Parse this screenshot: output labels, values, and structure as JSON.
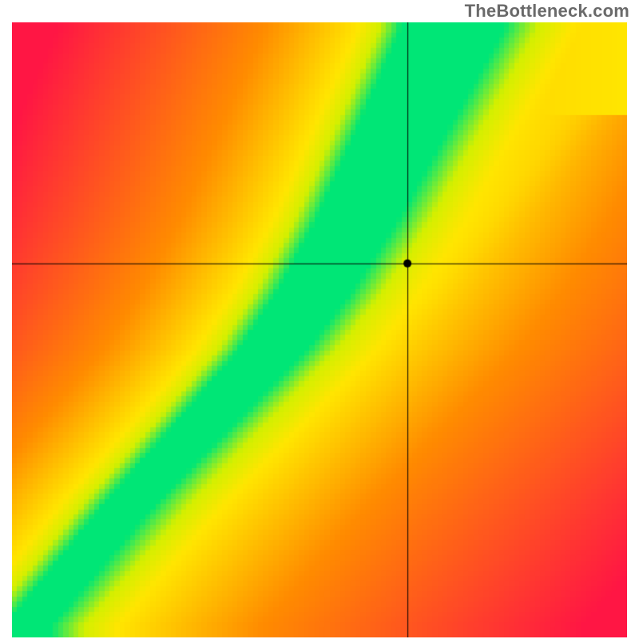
{
  "watermark": "TheBottleneck.com",
  "chart_data": {
    "type": "heatmap",
    "title": "",
    "xlabel": "",
    "ylabel": "",
    "xlim": [
      0,
      1
    ],
    "ylim": [
      0,
      1
    ],
    "crosshair": {
      "x": 0.643,
      "y": 0.608
    },
    "palette": {
      "red": "#ff1744",
      "orange": "#ff8c00",
      "yellow": "#ffe600",
      "yellowgreen": "#d4f000",
      "green": "#00e676"
    },
    "ridge": {
      "description": "Green optimal band: start narrow bottom-left, bow slightly right through center, end near top with right edge ~ x=0.75",
      "points_center": [
        {
          "x": 0.02,
          "y": 0.02
        },
        {
          "x": 0.19,
          "y": 0.22
        },
        {
          "x": 0.32,
          "y": 0.36
        },
        {
          "x": 0.42,
          "y": 0.47
        },
        {
          "x": 0.49,
          "y": 0.57
        },
        {
          "x": 0.555,
          "y": 0.68
        },
        {
          "x": 0.605,
          "y": 0.78
        },
        {
          "x": 0.655,
          "y": 0.88
        },
        {
          "x": 0.71,
          "y": 0.99
        }
      ],
      "width_bottom": 0.015,
      "width_top": 0.11
    },
    "secondary_ridge": {
      "description": "faint yellow ridge to the right of the main band, diverging toward top-right corner",
      "points_center": [
        {
          "x": 0.02,
          "y": 0.02
        },
        {
          "x": 0.3,
          "y": 0.25
        },
        {
          "x": 0.5,
          "y": 0.42
        },
        {
          "x": 0.65,
          "y": 0.55
        },
        {
          "x": 0.8,
          "y": 0.72
        },
        {
          "x": 0.98,
          "y": 0.95
        }
      ]
    },
    "corners": {
      "top_left": "red",
      "top_right": "yellow",
      "bottom_left": "yellow_small_then_red",
      "bottom_right": "red"
    }
  }
}
